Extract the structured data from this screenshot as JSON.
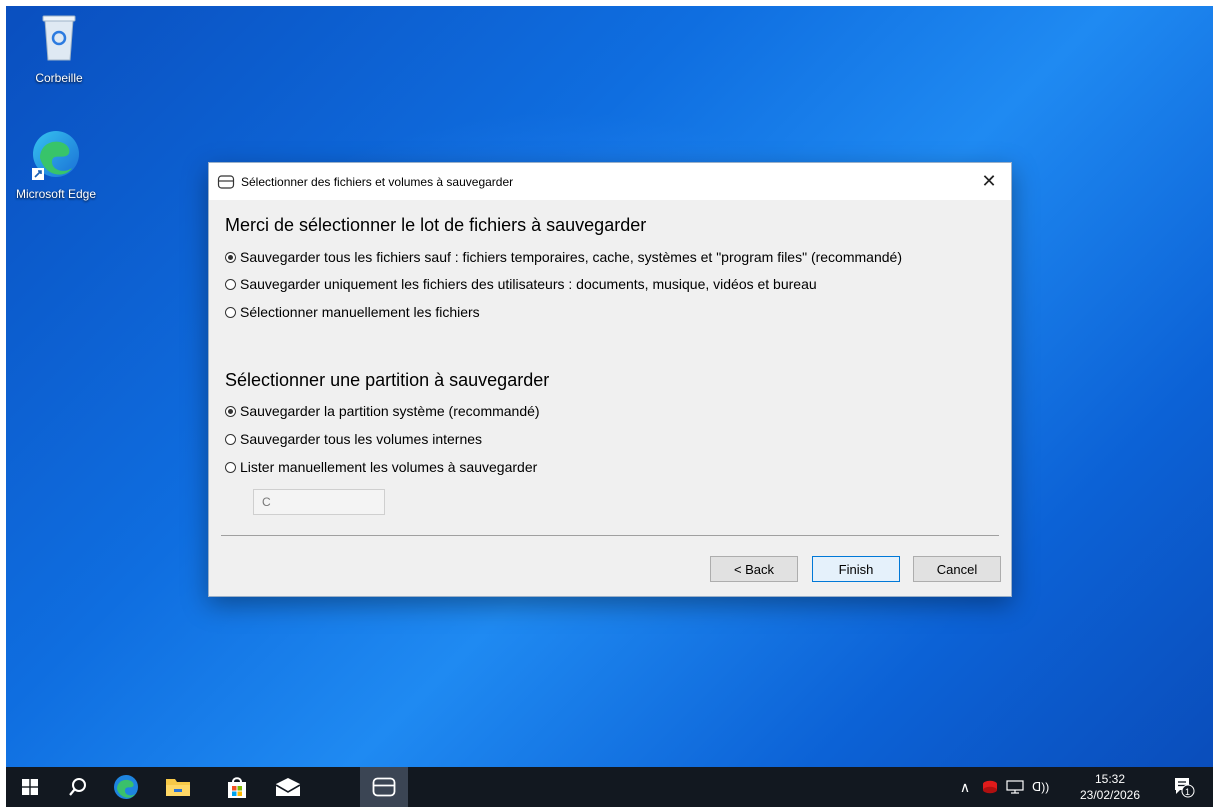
{
  "desktop": {
    "icons": [
      {
        "label": "Corbeille"
      },
      {
        "label": "Microsoft Edge"
      }
    ]
  },
  "dialog": {
    "title": "Sélectionner des fichiers et volumes à sauvegarder",
    "close_symbol": "✕",
    "files_section": {
      "heading": "Merci de sélectionner le lot de fichiers à sauvegarder",
      "options": [
        {
          "label": "Sauvegarder tous les fichiers sauf : fichiers temporaires, cache, systèmes et \"program files\" (recommandé)",
          "checked": true
        },
        {
          "label": "Sauvegarder uniquement les fichiers des utilisateurs : documents, musique, vidéos et bureau",
          "checked": false
        },
        {
          "label": "Sélectionner manuellement les fichiers",
          "checked": false
        }
      ]
    },
    "partition_section": {
      "heading": "Sélectionner une partition à sauvegarder",
      "options": [
        {
          "label": "Sauvegarder la partition système (recommandé)",
          "checked": true
        },
        {
          "label": "Sauvegarder tous les volumes internes",
          "checked": false
        },
        {
          "label": "Lister manuellement les volumes à sauvegarder",
          "checked": false
        }
      ],
      "volume_input_value": "C"
    },
    "buttons": {
      "back": "< Back",
      "finish": "Finish",
      "cancel": "Cancel"
    }
  },
  "taskbar": {
    "icons": [
      "windows-start-icon",
      "search-icon",
      "edge-icon",
      "file-explorer-icon",
      "store-icon",
      "mail-icon",
      "backup-app-icon"
    ],
    "tray": {
      "time": "15:32",
      "date": "23/02/2026",
      "notification_count": "1"
    }
  },
  "colors": {
    "accent": "#0078d7",
    "taskbar": "#121820",
    "dialog_bg": "#f0f0f0"
  }
}
